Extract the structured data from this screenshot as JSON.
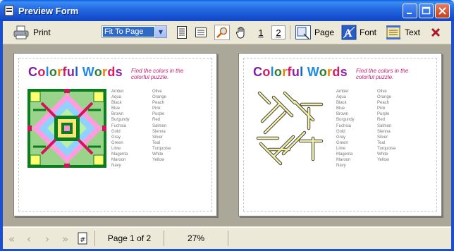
{
  "window": {
    "title": "Preview Form"
  },
  "toolbar": {
    "print_label": "Print",
    "zoom_value": "Fit To Page",
    "page_1": "1",
    "page_2": "2",
    "page_label": "Page",
    "font_label": "Font",
    "text_label": "Text"
  },
  "pages": [
    {
      "title_letters": [
        "C",
        "o",
        "l",
        "o",
        "r",
        "f",
        "u",
        "l",
        " ",
        "W",
        "o",
        "r",
        "d",
        "s"
      ],
      "subtitle": "Find the colors in the colorful puzzle.",
      "words_col1": [
        "Amber",
        "Aqua",
        "Black",
        "Blue",
        "Brown",
        "Burgundy",
        "Fuchsia",
        "Gold",
        "Gray",
        "Green",
        "Lime",
        "Magenta",
        "Maroon",
        "Navy"
      ],
      "words_col2": [
        "Olive",
        "Orange",
        "Peach",
        "Pink",
        "Purple",
        "Red",
        "Salmon",
        "Sienna",
        "Silver",
        "Teal",
        "Turquoise",
        "White",
        "Yellow"
      ]
    },
    {
      "title_letters": [
        "C",
        "o",
        "l",
        "o",
        "r",
        "f",
        "u",
        "l",
        " ",
        "W",
        "o",
        "r",
        "d",
        "s"
      ],
      "subtitle": "Find the colors in the colorful puzzle.",
      "words_col1": [
        "Amber",
        "Aqua",
        "Black",
        "Blue",
        "Brown",
        "Burgundy",
        "Fuchsia",
        "Gold",
        "Gray",
        "Green",
        "Lime",
        "Magenta",
        "Maroon",
        "Navy"
      ],
      "words_col2": [
        "Olive",
        "Orange",
        "Peach",
        "Pink",
        "Purple",
        "Red",
        "Salmon",
        "Sienna",
        "Silver",
        "Teal",
        "Turquoise",
        "White",
        "Yellow"
      ]
    }
  ],
  "title_colors": [
    "#7b1fa2",
    "#d81b60",
    "#1e88e5",
    "#2e7d32",
    "#f57c00",
    "#d81b60",
    "#8e24aa",
    "#1565c0",
    " ",
    "#1e88e5",
    "#2e7d32",
    "#f57c00",
    "#d81b60",
    "#8e24aa"
  ],
  "status": {
    "page_info": "Page 1 of 2",
    "zoom": "27%"
  }
}
